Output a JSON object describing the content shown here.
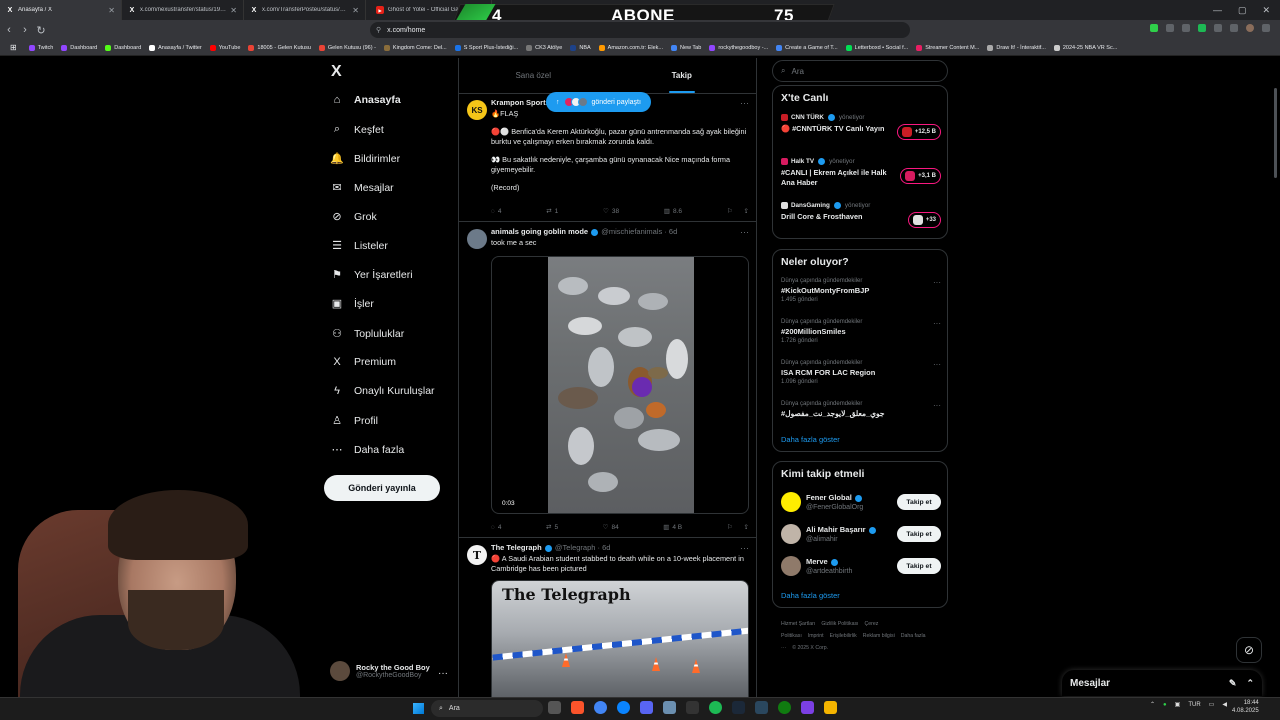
{
  "browser": {
    "tabs": [
      {
        "title": "Anasayfa / X",
        "active": true,
        "icon": "x-icon"
      },
      {
        "title": "x.com/nexustransfer/status/195239",
        "active": false,
        "icon": "x-icon"
      },
      {
        "title": "x.com/TransferPosteu/status/19523",
        "active": false,
        "icon": "x-icon"
      },
      {
        "title": "Ghost of Yotei - Official Gamepl",
        "active": false,
        "icon": "youtube-icon"
      }
    ],
    "url": "x.com/home",
    "bookmarks": [
      {
        "label": "Twitch",
        "color": "#9146ff"
      },
      {
        "label": "Dashboard",
        "color": "#9146ff"
      },
      {
        "label": "Dashboard",
        "color": "#53fc18"
      },
      {
        "label": "Anasayfa / Twitter",
        "color": "#ffffff"
      },
      {
        "label": "YouTube",
        "color": "#ff0000"
      },
      {
        "label": "18005 - Gelen Kutusu",
        "color": "#ea4335"
      },
      {
        "label": "Gelen Kutusu (96) -",
        "color": "#ea4335"
      },
      {
        "label": "Kingdom Come: Del...",
        "color": "#8a6d3b"
      },
      {
        "label": "S Sport Plus-İstediği...",
        "color": "#1a73e8"
      },
      {
        "label": "CK3 Atölye",
        "color": "#777777"
      },
      {
        "label": "NBA",
        "color": "#1d428a"
      },
      {
        "label": "Amazon.com.tr: Elek...",
        "color": "#ff9900"
      },
      {
        "label": "New Tab",
        "color": "#4285f4"
      },
      {
        "label": "rockythegoodboy -...",
        "color": "#9146ff"
      },
      {
        "label": "Create a Game of T...",
        "color": "#4285f4"
      },
      {
        "label": "Letterboxd • Social f...",
        "color": "#00e054"
      },
      {
        "label": "Streamer Content M...",
        "color": "#e91e63"
      },
      {
        "label": "Draw It! - İnteraktif...",
        "color": "#aaaaaa"
      },
      {
        "label": "2024-25 NBA VR Sc...",
        "color": "#cccccc"
      }
    ]
  },
  "stream_overlay": {
    "left": "4",
    "middle": "ABONE",
    "right": "75",
    "accent": "#2fd04a"
  },
  "nav": {
    "logo": "X",
    "items": [
      {
        "label": "Anasayfa",
        "icon": "home-icon",
        "glyph": "⌂",
        "bold": true
      },
      {
        "label": "Keşfet",
        "icon": "search-icon",
        "glyph": "⌕"
      },
      {
        "label": "Bildirimler",
        "icon": "bell-icon",
        "glyph": "🔔"
      },
      {
        "label": "Mesajlar",
        "icon": "mail-icon",
        "glyph": "✉"
      },
      {
        "label": "Grok",
        "icon": "grok-icon",
        "glyph": "⊘"
      },
      {
        "label": "Listeler",
        "icon": "list-icon",
        "glyph": "☰"
      },
      {
        "label": "Yer İşaretleri",
        "icon": "bookmark-icon",
        "glyph": "⚑"
      },
      {
        "label": "İşler",
        "icon": "briefcase-icon",
        "glyph": "▣"
      },
      {
        "label": "Topluluklar",
        "icon": "communities-icon",
        "glyph": "⚇"
      },
      {
        "label": "Premium",
        "icon": "x-premium-icon",
        "glyph": "X"
      },
      {
        "label": "Onaylı Kuruluşlar",
        "icon": "lightning-icon",
        "glyph": "ϟ"
      },
      {
        "label": "Profil",
        "icon": "profile-icon",
        "glyph": "♙"
      },
      {
        "label": "Daha fazla",
        "icon": "more-circle-icon",
        "glyph": "⋯"
      }
    ],
    "post_button": "Gönderi yayınla",
    "account": {
      "name": "Rocky the Good Boy",
      "handle": "@RockytheGoodBoy"
    }
  },
  "feed": {
    "tabs": [
      "Sana özel",
      "Takip"
    ],
    "active_tab": "Takip",
    "new_posts_pill": "gönderi paylaştı",
    "tweets": [
      {
        "name": "Krampon Sports",
        "handle": "",
        "time": "",
        "line1": "🔥FLAŞ",
        "text": "🔴⚪ Benfica'da Kerem Aktürkoğlu, pazar günü antrenmanda sağ ayak bileğini burktu ve çalışmayı erken bırakmak zorunda kaldı.",
        "text2": "👀 Bu sakatlık nedeniyle, çarşamba günü oynanacak Nice maçında forma giyemeyebilir.",
        "text3": "(Record)",
        "stats": {
          "replies": "4",
          "reposts": "1",
          "likes": "38",
          "views": "8.6"
        }
      },
      {
        "name": "animals going goblin mode",
        "handle": "@mischiefanimals",
        "time": "· 6d",
        "text": "took me a sec",
        "video_time": "0:03",
        "stats": {
          "replies": "4",
          "reposts": "5",
          "likes": "84",
          "views": "4 B"
        }
      },
      {
        "name": "The Telegraph",
        "handle": "@Telegraph",
        "time": "· 6d",
        "text": "🔴 A Saudi Arabian student stabbed to death while on a 10-week placement in Cambridge has been pictured",
        "image_masthead": "The Telegraph"
      }
    ]
  },
  "right": {
    "search_placeholder": "Ara",
    "live": {
      "title": "X'te Canlı",
      "items": [
        {
          "source": "CNN TÜRK",
          "meta": "yönetiyor",
          "title": "🔴 #CNNTÜRK TV Canlı Yayın",
          "badge": "+12,5 B",
          "color": "#c81d25"
        },
        {
          "source": "Halk TV",
          "meta": "yönetiyor",
          "title": "#CANLI | Ekrem Açıkel ile Halk Ana Haber",
          "badge": "+3,1 B",
          "color": "#d81b60"
        },
        {
          "source": "DansGaming",
          "meta": "yönetiyor",
          "title": "Drill Core & Frosthaven",
          "badge": "+33",
          "color": "#e0e0e0"
        }
      ]
    },
    "trends": {
      "title": "Neler oluyor?",
      "items": [
        {
          "context": "Dünya çapında gündemdekiler",
          "name": "#KickOutMontyFromBJP",
          "count": "1.495 gönderi"
        },
        {
          "context": "Dünya çapında gündemdekiler",
          "name": "#200MillionSmiles",
          "count": "1.726 gönderi"
        },
        {
          "context": "Dünya çapında gündemdekiler",
          "name": "ISA RCM FOR LAC Region",
          "count": "1.096 gönderi"
        },
        {
          "context": "Dünya çapında gündemdekiler",
          "name": "#جوي_معلق_لايوجد_نت_مفصول",
          "count": ""
        }
      ],
      "show_more": "Daha fazla göster"
    },
    "who_to_follow": {
      "title": "Kimi takip etmeli",
      "items": [
        {
          "name": "Fener Global",
          "handle": "@FenerGlobalOrg",
          "button": "Takip et",
          "color": "#ffed00"
        },
        {
          "name": "Ali Mahir Başarır",
          "handle": "@alimahir",
          "button": "Takip et",
          "color": "#c0b4a8"
        },
        {
          "name": "Merve",
          "handle": "@artdeathbirth",
          "button": "Takip et",
          "color": "#8f7a6a"
        }
      ],
      "show_more": "Daha fazla göster"
    },
    "footer": [
      "Hizmet Şartları",
      "Gizlilik Politikası",
      "Çerez Politikası",
      "Imprint",
      "Erişilebilirlik",
      "Reklam bilgisi",
      "Daha fazla ···",
      "© 2025 X Corp."
    ]
  },
  "messages_drawer": {
    "label": "Mesajlar"
  },
  "taskbar": {
    "search": "Ara",
    "lang": "TUR",
    "time": "18:44",
    "date": "4.08.2025"
  }
}
